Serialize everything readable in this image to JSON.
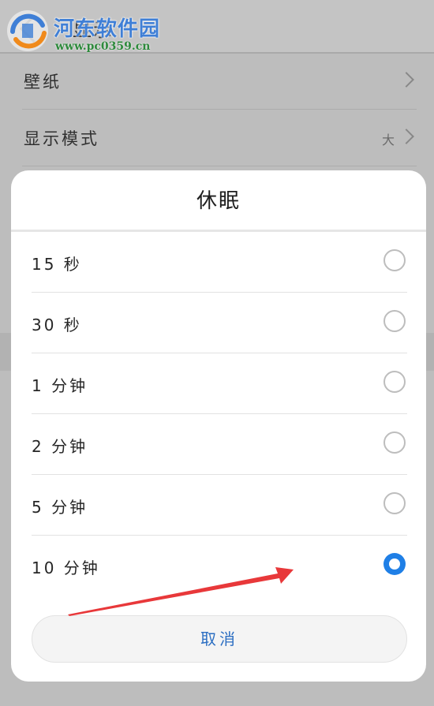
{
  "background_screen": {
    "header_title": "显示",
    "rows": [
      {
        "label": "壁纸",
        "value": ""
      },
      {
        "label": "显示模式",
        "value": "大"
      }
    ]
  },
  "watermark": {
    "name": "河东软件园",
    "url": "www.pc0359.cn"
  },
  "dialog": {
    "title": "休眠",
    "options": [
      {
        "label": "15 秒",
        "selected": false
      },
      {
        "label": "30 秒",
        "selected": false
      },
      {
        "label": "1 分钟",
        "selected": false
      },
      {
        "label": "2 分钟",
        "selected": false
      },
      {
        "label": "5 分钟",
        "selected": false
      },
      {
        "label": "10 分钟",
        "selected": true
      }
    ],
    "cancel_label": "取消"
  },
  "colors": {
    "accent": "#1f7fe6",
    "cancel_text": "#2b6ec2",
    "annotation_arrow": "#e8383a"
  },
  "icons": {
    "back": "back-arrow-icon",
    "chevron": "chevron-right-icon",
    "radio_off": "radio-unchecked-icon",
    "radio_on": "radio-checked-icon",
    "annotation": "red-arrow-icon"
  }
}
